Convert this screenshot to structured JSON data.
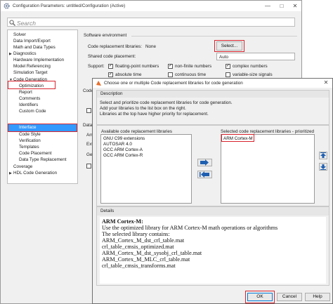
{
  "main_window": {
    "title": "Configuration Parameters: untitled/Configuration (Active)",
    "search_placeholder": "Search"
  },
  "tree": {
    "items": [
      {
        "label": "Solver"
      },
      {
        "label": "Data Import/Export"
      },
      {
        "label": "Math and Data Types"
      },
      {
        "label": "Diagnostics"
      },
      {
        "label": "Hardware Implementation"
      },
      {
        "label": "Model Referencing"
      },
      {
        "label": "Simulation Target"
      },
      {
        "label": "Code Generation"
      },
      {
        "label": "Optimization"
      },
      {
        "label": "Report"
      },
      {
        "label": "Comments"
      },
      {
        "label": "Identifiers"
      },
      {
        "label": "Custom Code"
      },
      {
        "label": "Interface"
      },
      {
        "label": "Code Style"
      },
      {
        "label": "Verification"
      },
      {
        "label": "Templates"
      },
      {
        "label": "Code Placement"
      },
      {
        "label": "Data Type Replacement"
      },
      {
        "label": "Coverage"
      },
      {
        "label": "HDL Code Generation"
      }
    ]
  },
  "software_env": {
    "header": "Software environment",
    "libraries_label": "Code replacement libraries:",
    "libraries_value": "None",
    "select_button": "Select...",
    "placement_label": "Shared code placement:",
    "placement_value": "Auto",
    "support_label": "Support:",
    "support_options": [
      {
        "label": "floating-point numbers",
        "checked": true
      },
      {
        "label": "non-finite numbers",
        "checked": true
      },
      {
        "label": "complex numbers",
        "checked": true
      },
      {
        "label": "absolute time",
        "checked": true
      },
      {
        "label": "continuous time",
        "checked": false
      },
      {
        "label": "variable-size signals",
        "checked": false
      }
    ],
    "partial_labels": [
      "Code",
      "Data e",
      "Arra",
      "Exte",
      "Gen"
    ]
  },
  "dialog": {
    "title": "Choose one or multiple Code replacement libraries for code generation",
    "description_header": "Description",
    "description_text": [
      "Select and prioritize code replacement libraries for code generation.",
      "Add your libraries to the list box on the right.",
      "Libraries at the top have higher priority for replacement."
    ],
    "available_header": "Available code replacement libraries",
    "available_items": [
      "GNU C99 extensions",
      "AUTOSAR 4.0",
      "GCC ARM Cortex-A",
      "GCC ARM Cortex-R"
    ],
    "selected_header": "Selected code replacement libraries - prioritized",
    "selected_items": [
      "ARM Cortex-M"
    ],
    "details_header": "Details",
    "details_title": "ARM Cortex-M:",
    "details_lines": [
      "Use the optimized library for ARM Cortex-M math operations or algorithms",
      "The selected library contains:",
      "ARM_Cortex_M_dst_crl_table.mat",
      "crl_table_cmsis_optimized.mat",
      "ARM_Cortex_M_dst_sysobj_crl_table.mat",
      "ARM_Cortex_M_MLC_crl_table.mat",
      "crl_table_cmsis_transforms.mat"
    ],
    "ok_button": "OK",
    "cancel_button": "Cancel",
    "help_button": "Help"
  },
  "colors": {
    "highlight_red": "#d9232d",
    "selection_blue": "#3399ff",
    "arrow_blue": "#1f5fb0"
  }
}
